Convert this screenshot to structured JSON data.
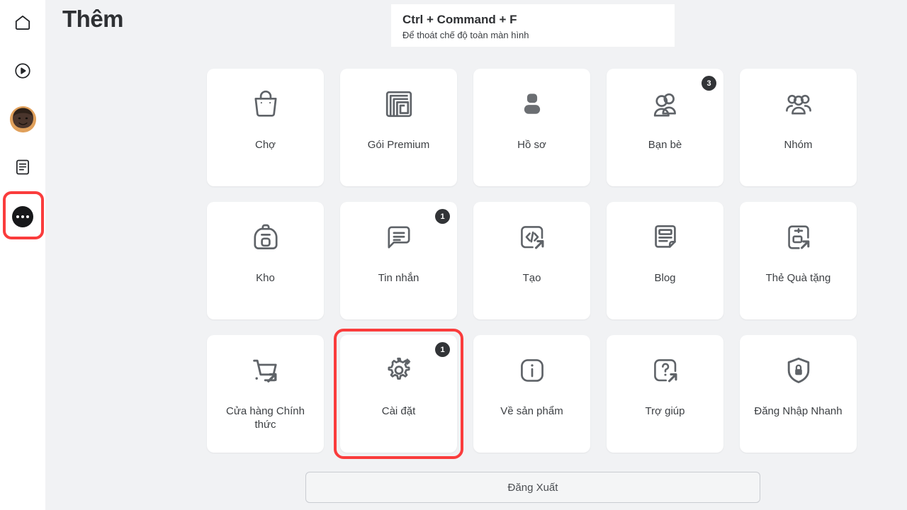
{
  "header": {
    "title": "Thêm"
  },
  "tooltip": {
    "shortcut": "Ctrl + Command + F",
    "description": "Để thoát chế độ toàn màn hình"
  },
  "sidebar": {
    "items": [
      {
        "name": "home",
        "icon": "home-icon"
      },
      {
        "name": "video",
        "icon": "play-circle-icon"
      },
      {
        "name": "avatar",
        "icon": "avatar-icon"
      },
      {
        "name": "feed",
        "icon": "feed-icon"
      },
      {
        "name": "more",
        "icon": "ellipsis-icon",
        "selected": true
      }
    ]
  },
  "grid": {
    "cards": [
      {
        "label": "Chợ",
        "icon": "shopping-bag-icon",
        "badge": ""
      },
      {
        "label": "Gói Premium",
        "icon": "premium-spiral-icon",
        "badge": ""
      },
      {
        "label": "Hồ sơ",
        "icon": "profile-icon",
        "badge": ""
      },
      {
        "label": "Bạn bè",
        "icon": "friends-icon",
        "badge": "3"
      },
      {
        "label": "Nhóm",
        "icon": "groups-icon",
        "badge": ""
      },
      {
        "label": "Kho",
        "icon": "backpack-icon",
        "badge": ""
      },
      {
        "label": "Tin nhắn",
        "icon": "message-icon",
        "badge": "1"
      },
      {
        "label": "Tạo",
        "icon": "code-external-icon",
        "badge": ""
      },
      {
        "label": "Blog",
        "icon": "blog-icon",
        "badge": ""
      },
      {
        "label": "Thẻ Quà tặng",
        "icon": "gift-card-icon",
        "badge": ""
      },
      {
        "label": "Cửa hàng Chính thức",
        "icon": "cart-external-icon",
        "badge": ""
      },
      {
        "label": "Cài đặt",
        "icon": "gear-icon",
        "badge": "1",
        "highlighted": true
      },
      {
        "label": "Về sản phẩm",
        "icon": "info-icon",
        "badge": ""
      },
      {
        "label": "Trợ giúp",
        "icon": "help-external-icon",
        "badge": ""
      },
      {
        "label": "Đăng Nhập Nhanh",
        "icon": "shield-lock-icon",
        "badge": ""
      }
    ]
  },
  "footer": {
    "logout_label": "Đăng Xuất"
  },
  "colors": {
    "background": "#f1f2f4",
    "card": "#ffffff",
    "highlight": "#fa3c3c",
    "badge": "#323437",
    "icon_stroke": "#5f6368",
    "text": "#3d4044"
  }
}
